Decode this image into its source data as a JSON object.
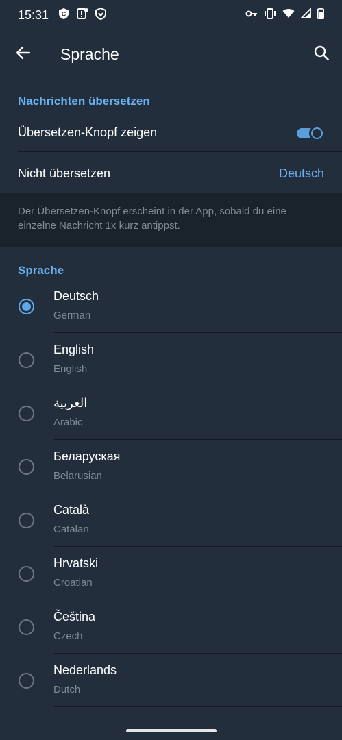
{
  "status_bar": {
    "time": "15:31",
    "left_icons": [
      "shield-c-icon",
      "sim-alert-icon",
      "vpn-shield-icon"
    ],
    "right_icons": [
      "key-icon",
      "vibrate-icon",
      "wifi-icon",
      "signal-icon",
      "battery-icon"
    ]
  },
  "app_bar": {
    "title": "Sprache",
    "back_icon": "arrow-back-icon",
    "search_icon": "search-icon"
  },
  "translate_section": {
    "header": "Nachrichten übersetzen",
    "show_button_label": "Übersetzen-Knopf zeigen",
    "show_button_enabled": true,
    "do_not_translate_label": "Nicht übersetzen",
    "do_not_translate_value": "Deutsch"
  },
  "info": {
    "text": "Der Übersetzen-Knopf erscheint in der App, sobald du eine einzelne Nachricht 1x kurz antippst."
  },
  "language_section": {
    "header": "Sprache",
    "items": [
      {
        "name": "Deutsch",
        "sub": "German",
        "selected": true
      },
      {
        "name": "English",
        "sub": "English",
        "selected": false
      },
      {
        "name": "العربية",
        "sub": "Arabic",
        "selected": false
      },
      {
        "name": "Беларуская",
        "sub": "Belarusian",
        "selected": false
      },
      {
        "name": "Català",
        "sub": "Catalan",
        "selected": false
      },
      {
        "name": "Hrvatski",
        "sub": "Croatian",
        "selected": false
      },
      {
        "name": "Čeština",
        "sub": "Czech",
        "selected": false
      },
      {
        "name": "Nederlands",
        "sub": "Dutch",
        "selected": false
      }
    ]
  },
  "colors": {
    "accent": "#6ab3f3",
    "background": "#1d2733",
    "surface": "#232e3c"
  }
}
